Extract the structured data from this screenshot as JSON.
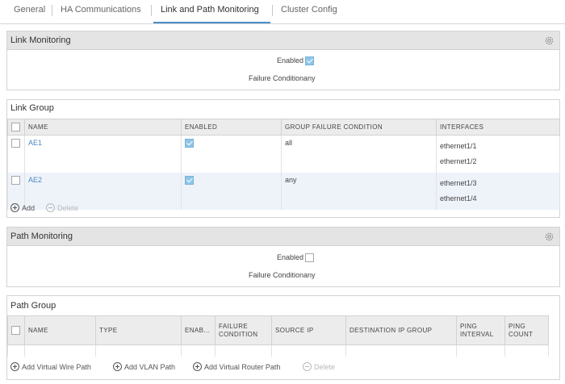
{
  "tabs": [
    "General",
    "HA Communications",
    "Link and Path Monitoring",
    "Cluster Config"
  ],
  "link_monitoring": {
    "title": "Link Monitoring",
    "enabled_label": "Enabled",
    "enabled": true,
    "failure_label": "Failure Condition",
    "failure_value": "any"
  },
  "link_group": {
    "title": "Link Group",
    "columns": [
      "NAME",
      "ENABLED",
      "GROUP FAILURE CONDITION",
      "INTERFACES"
    ],
    "rows": [
      {
        "name": "AE1",
        "enabled": true,
        "condition": "all",
        "interfaces": [
          "ethernet1/1",
          "ethernet1/2"
        ]
      },
      {
        "name": "AE2",
        "enabled": true,
        "condition": "any",
        "interfaces": [
          "ethernet1/3",
          "ethernet1/4"
        ]
      }
    ],
    "add_label": "Add",
    "delete_label": "Delete"
  },
  "path_monitoring": {
    "title": "Path Monitoring",
    "enabled_label": "Enabled",
    "enabled": false,
    "failure_label": "Failure Condition",
    "failure_value": "any"
  },
  "path_group": {
    "title": "Path Group",
    "columns": [
      "NAME",
      "TYPE",
      "ENAB...",
      "FAILURE CONDITION",
      "SOURCE IP",
      "DESTINATION IP GROUP",
      "PING INTERVAL",
      "PING COUNT"
    ],
    "add_vwire_label": "Add Virtual Wire Path",
    "add_vlan_label": "Add VLAN Path",
    "add_vrouter_label": "Add Virtual Router Path",
    "delete_label": "Delete"
  },
  "colors": {
    "accent": "#4a8ec8",
    "checkbox_on": "#8dc6e8",
    "header_bg": "#e4e4e4"
  }
}
